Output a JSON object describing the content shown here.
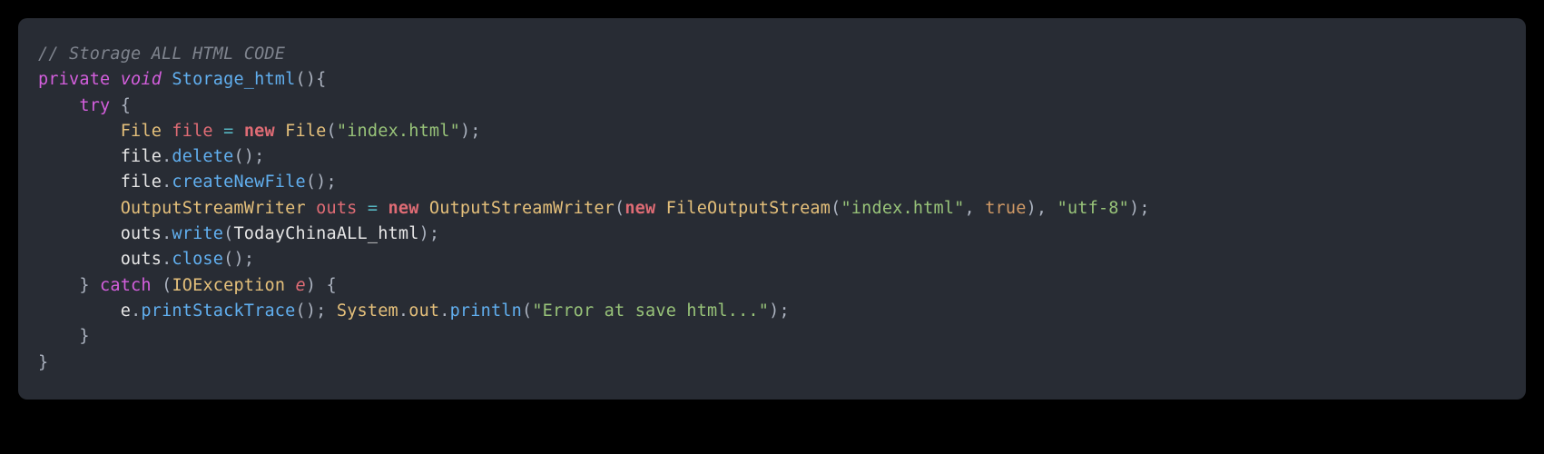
{
  "code": {
    "comment": "// Storage ALL HTML CODE",
    "kw_private": "private",
    "kw_void": "void",
    "fn_storage": "Storage_html",
    "kw_try": "try",
    "type_file": "File",
    "var_file": "file",
    "op_eq": "=",
    "kw_new": "new",
    "ctor_file": "File",
    "str_index": "\"index.html\"",
    "m_delete": "delete",
    "m_createNewFile": "createNewFile",
    "type_osw": "OutputStreamWriter",
    "var_outs": "outs",
    "ctor_osw": "OutputStreamWriter",
    "ctor_fos": "FileOutputStream",
    "str_index2": "\"index.html\"",
    "bool_true": "true",
    "str_utf8": "\"utf-8\"",
    "m_write": "write",
    "arg_today": "TodayChinaALL_html",
    "m_close": "close",
    "kw_catch": "catch",
    "type_ioex": "IOException",
    "var_e": "e",
    "m_printStackTrace": "printStackTrace",
    "cls_system": "System",
    "fld_out": "out",
    "m_println": "println",
    "str_err": "\"Error at save html...\"",
    "p_open": "(",
    "p_close": ")",
    "b_open": "{",
    "b_close": "}",
    "semi": ";",
    "dot": ".",
    "comma": ",",
    "sp": " "
  }
}
